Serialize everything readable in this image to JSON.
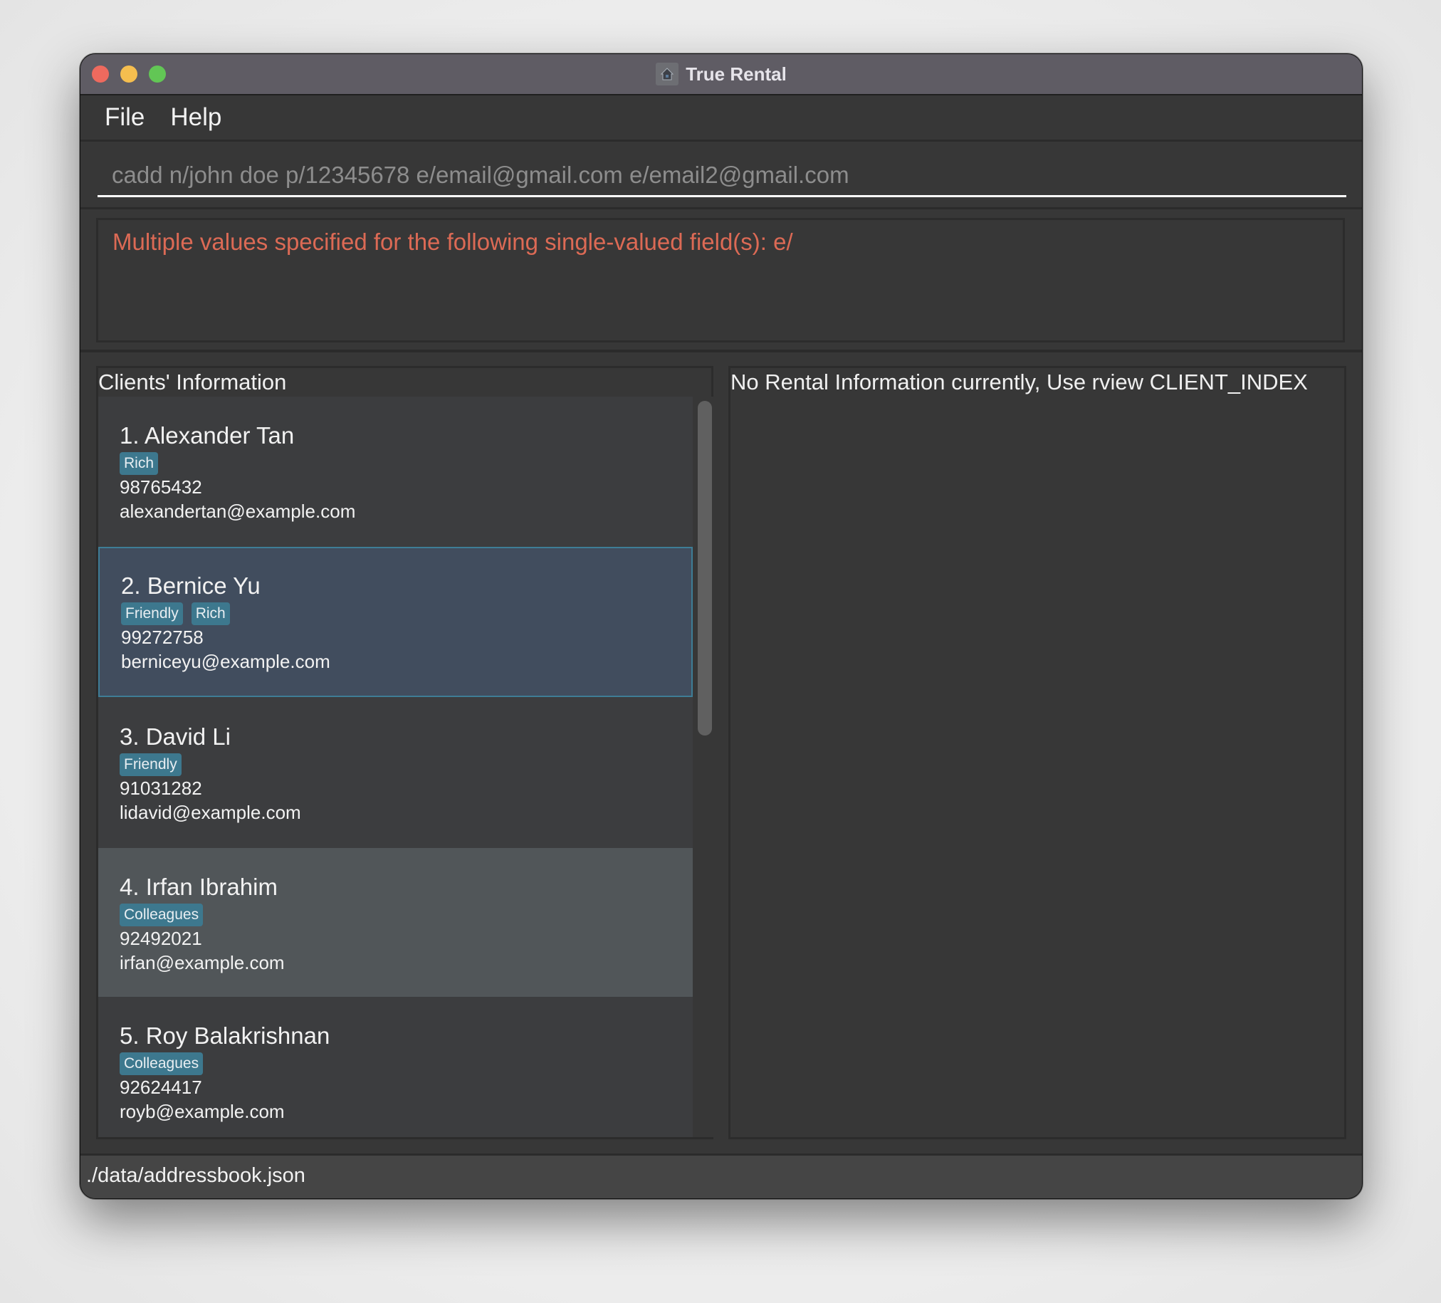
{
  "window": {
    "title": "True Rental",
    "icon": "house-app-icon"
  },
  "menu": {
    "items": [
      {
        "label": "File"
      },
      {
        "label": "Help"
      }
    ]
  },
  "command_box": {
    "value": "cadd n/john doe p/12345678 e/email@gmail.com e/email2@gmail.com"
  },
  "result_display": {
    "message": "Multiple values specified for the following single-valued field(s): e/",
    "color": "#dc6a55"
  },
  "client_panel": {
    "title": "Clients' Information",
    "clients": [
      {
        "name": "1. Alexander Tan",
        "tags": [
          "Rich"
        ],
        "phone": "98765432",
        "email": "alexandertan@example.com",
        "state": "normal"
      },
      {
        "name": "2. Bernice Yu",
        "tags": [
          "Friendly",
          "Rich"
        ],
        "phone": "99272758",
        "email": "berniceyu@example.com",
        "state": "selected"
      },
      {
        "name": "3. David Li",
        "tags": [
          "Friendly"
        ],
        "phone": "91031282",
        "email": "lidavid@example.com",
        "state": "normal"
      },
      {
        "name": "4. Irfan Ibrahim",
        "tags": [
          "Colleagues"
        ],
        "phone": "92492021",
        "email": "irfan@example.com",
        "state": "hovered"
      },
      {
        "name": "5. Roy Balakrishnan",
        "tags": [
          "Colleagues"
        ],
        "phone": "92624417",
        "email": "royb@example.com",
        "state": "normal"
      }
    ]
  },
  "rental_panel": {
    "message": "No Rental Information currently, Use rview CLIENT_INDEX"
  },
  "status_bar": {
    "path": "./data/addressbook.json"
  },
  "colors": {
    "tag": "#3d788e",
    "selected_border": "#3e7d96",
    "selected_bg": "#414d5e"
  }
}
